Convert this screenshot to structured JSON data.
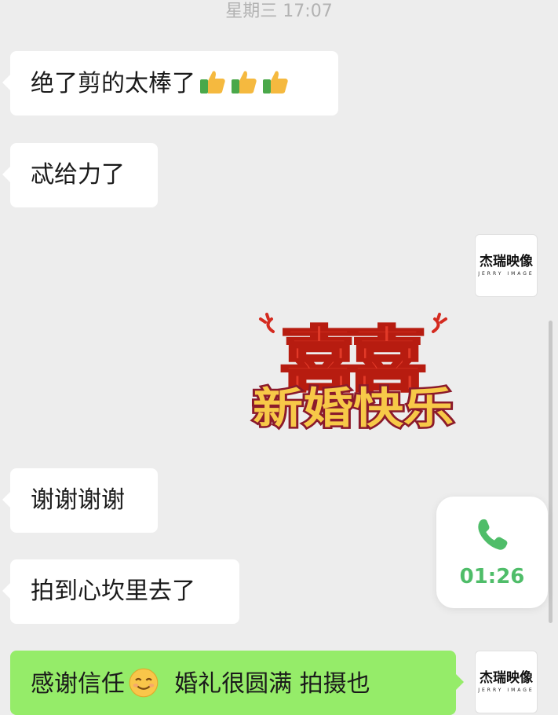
{
  "header": {
    "timestamp": "星期三 17:07"
  },
  "messages": [
    {
      "text": "绝了剪的太棒了",
      "emoji": [
        "thumbs-up",
        "thumbs-up",
        "thumbs-up"
      ]
    },
    {
      "text": "忒给力了"
    },
    {
      "text": "谢谢谢谢"
    },
    {
      "text": "拍到心坎里去了"
    },
    {
      "text_a": "感谢信任",
      "emoji": "smile",
      "text_b": "  婚礼很圆满 拍摄也"
    }
  ],
  "avatar": {
    "name_cn": "杰瑞映像",
    "name_en": "JERRY IMAGE"
  },
  "sticker": {
    "big": "囍",
    "caption": "新婚快乐"
  },
  "call": {
    "duration": "01:26"
  },
  "colors": {
    "bg": "#ededed",
    "sent_bubble": "#95ec69",
    "call_green": "#4fbd69"
  }
}
